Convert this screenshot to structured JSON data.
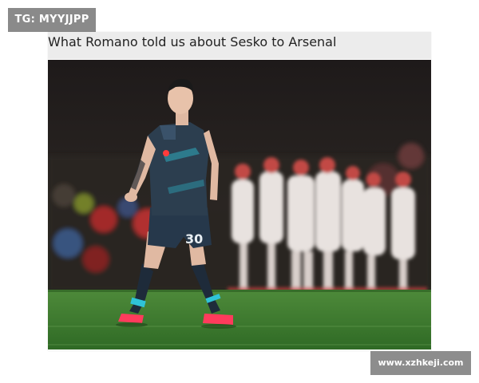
{
  "tag_badge": "TG: MYYJJPP",
  "article": {
    "headline": "What Romano told us about Sesko to Arsenal",
    "photo": {
      "player_number": "30"
    }
  },
  "watermark_url": "www.xzhkeji.com",
  "colors": {
    "badge_bg": "#8a8a8a",
    "headline_bg": "#ececec",
    "pitch_green": "#3f7d32",
    "kit_dark": "#2c3e4f",
    "boots": "#ff3b5c"
  }
}
